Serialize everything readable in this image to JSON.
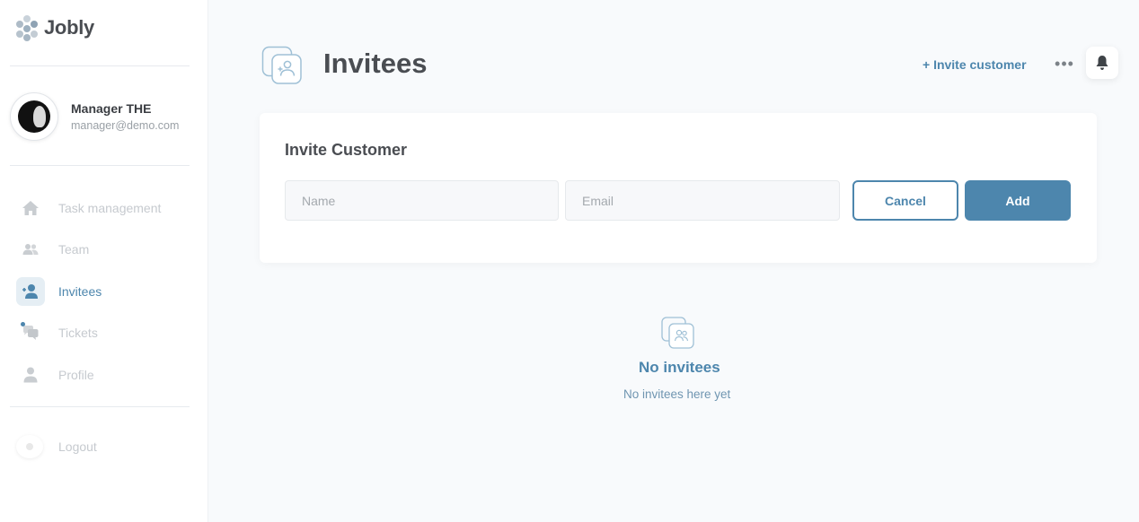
{
  "brand": {
    "name": "Jobly"
  },
  "user": {
    "name": "Manager THE",
    "email": "manager@demo.com"
  },
  "nav": {
    "items": [
      {
        "label": "Task management",
        "icon": "home-icon"
      },
      {
        "label": "Team",
        "icon": "team-icon"
      },
      {
        "label": "Invitees",
        "icon": "add-user-icon",
        "active": true
      },
      {
        "label": "Tickets",
        "icon": "chat-bubbles-icon"
      },
      {
        "label": "Profile",
        "icon": "person-icon"
      }
    ],
    "logout_label": "Logout"
  },
  "header": {
    "title": "Invitees",
    "invite_link": "+ Invite customer",
    "more_label": "•••"
  },
  "invite_card": {
    "title": "Invite Customer",
    "name_placeholder": "Name",
    "name_value": "",
    "email_placeholder": "Email",
    "email_value": "",
    "cancel_label": "Cancel",
    "add_label": "Add"
  },
  "empty_state": {
    "title": "No invitees",
    "subtitle": "No invitees here yet"
  },
  "colors": {
    "accent": "#4d86ad",
    "background": "#f8fafc",
    "sidebar": "#ffffff",
    "muted_text": "#c6cacf"
  }
}
